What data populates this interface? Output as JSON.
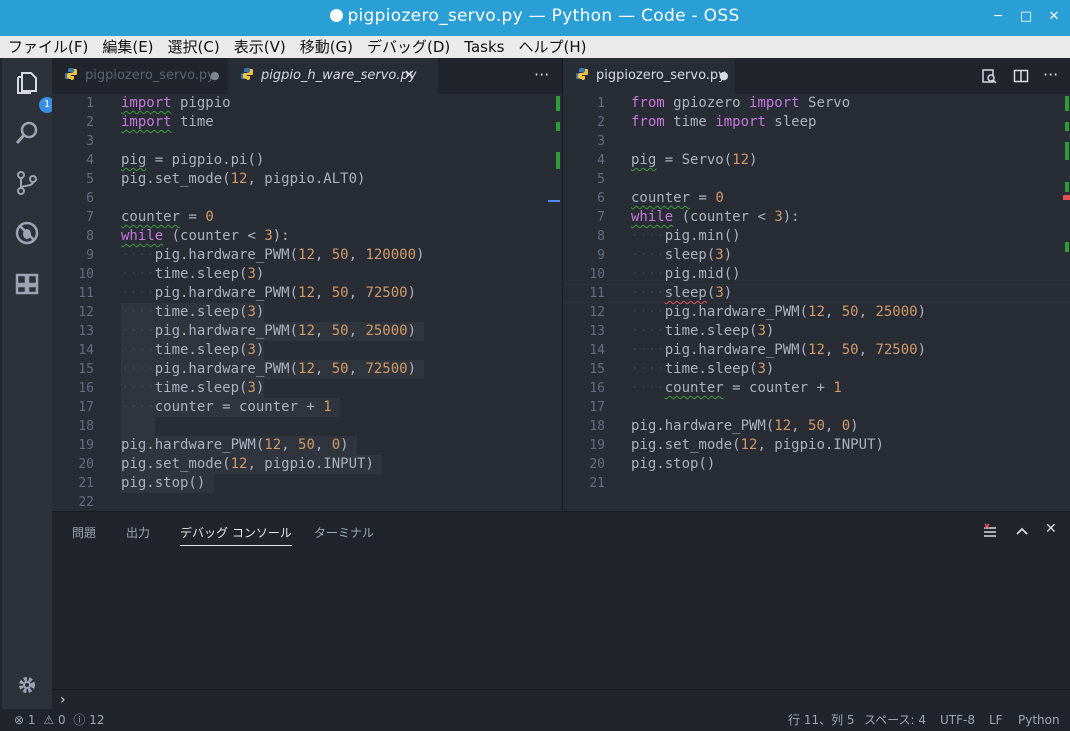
{
  "window": {
    "title": "pigpiozero_servo.py — Python — Code - OSS"
  },
  "menu": [
    "ファイル(F)",
    "編集(E)",
    "選択(C)",
    "表示(V)",
    "移動(G)",
    "デバッグ(D)",
    "Tasks",
    "ヘルプ(H)"
  ],
  "activity": {
    "explorer_badge": "1"
  },
  "left_editor": {
    "tabs": [
      {
        "label": "pigpiozero_servo.py"
      },
      {
        "label": "pigpio_h_ware_servo.py"
      }
    ],
    "line_numbers": [
      "1",
      "2",
      "3",
      "4",
      "5",
      "6",
      "7",
      "8",
      "9",
      "10",
      "11",
      "12",
      "13",
      "14",
      "15",
      "16",
      "17",
      "18",
      "19",
      "20",
      "21",
      "22"
    ]
  },
  "right_editor": {
    "tabs": [
      {
        "label": "pigpiozero_servo.py"
      }
    ],
    "line_numbers": [
      "1",
      "2",
      "3",
      "4",
      "5",
      "6",
      "7",
      "8",
      "9",
      "10",
      "11",
      "12",
      "13",
      "14",
      "15",
      "16",
      "17",
      "18",
      "19",
      "20",
      "21"
    ]
  },
  "panel": {
    "tabs": [
      "問題",
      "出力",
      "デバッグ コンソール",
      "ターミナル"
    ],
    "prompt": "›"
  },
  "status": {
    "errors": "1",
    "warnings": "0",
    "infos": "12",
    "position": "行 11、列 5",
    "spaces": "スペース: 4",
    "encoding": "UTF-8",
    "eol": "LF",
    "language": "Python"
  },
  "colors": {
    "titlebar": "#2a9fd6",
    "editor_bg": "#282c34",
    "keyword": "#c678dd",
    "number": "#d19a66",
    "text": "#abb2bf"
  }
}
